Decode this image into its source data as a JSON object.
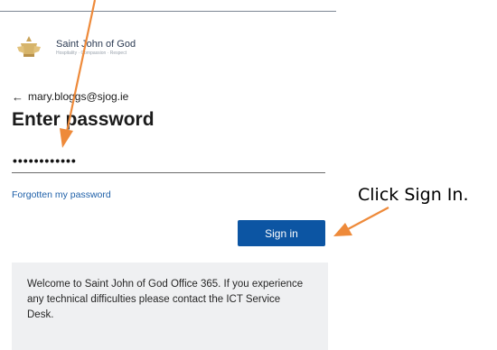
{
  "brand": {
    "name": "Saint John of God",
    "tagline": "Hospitality · Compassion · Respect",
    "logo_icon": "emblem-icon"
  },
  "login": {
    "back_arrow": "←",
    "account_email": "mary.bloggs@sjog.ie",
    "title": "Enter password",
    "password_value": "••••••••••••",
    "forgot_link": "Forgotten my password",
    "sign_in_label": "Sign in",
    "welcome_message": "Welcome to Saint John of God Office 365. If you experience any technical difficulties please contact the ICT Service Desk."
  },
  "annotations": {
    "instruction": "Click Sign In.",
    "arrow_color": "#ee8a3a"
  },
  "colors": {
    "button": "#0c55a3",
    "link": "#1d5fa8",
    "panel": "#eff0f2"
  }
}
